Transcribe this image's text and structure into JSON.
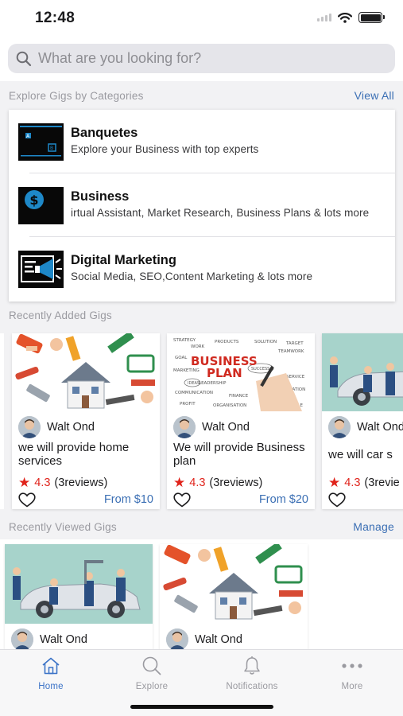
{
  "status_bar": {
    "time": "12:48"
  },
  "search": {
    "placeholder": "What are you looking for?",
    "value": ""
  },
  "categories_section": {
    "title": "Explore Gigs by Categories",
    "link": "View All"
  },
  "categories": [
    {
      "name": "Banquetes",
      "description": "Explore your Business   with top experts",
      "icon": "banquet-thumb"
    },
    {
      "name": "Business",
      "description": "irtual Assistant, Market Research, Business Plans & lots more",
      "icon": "dollar-thumb"
    },
    {
      "name": "Digital Marketing",
      "description": "Social Media, SEO,Content Marketing & lots more",
      "icon": "megaphone-thumb"
    }
  ],
  "recent_added_section": {
    "title": "Recently Added Gigs"
  },
  "gigs": [
    {
      "seller": "Walt Ond",
      "title": "we will provide home services",
      "rating": "4.3",
      "reviews": "(3reviews)",
      "price": "From $10",
      "image": "home-services-image"
    },
    {
      "seller": "Walt Ond",
      "title": "We will provide Business plan",
      "rating": "4.3",
      "reviews": "(3reviews)",
      "price": "From $20",
      "image": "business-plan-image"
    },
    {
      "seller": "Walt Ond",
      "title": "we will car s",
      "rating": "4.3",
      "reviews": "(3revie",
      "price": "",
      "image": "car-service-image"
    }
  ],
  "business_plan_art": {
    "headline_1": "BUSINESS",
    "headline_2": "PLAN"
  },
  "recent_viewed_section": {
    "title": "Recently Viewed Gigs",
    "link": "Manage"
  },
  "viewed": [
    {
      "seller": "Walt Ond",
      "image": "car-service-image"
    },
    {
      "seller": "Walt Ond",
      "image": "home-services-image"
    }
  ],
  "tabs": [
    {
      "label": "Home",
      "icon": "home-icon",
      "active": true
    },
    {
      "label": "Explore",
      "icon": "search-icon",
      "active": false
    },
    {
      "label": "Notifications",
      "icon": "bell-icon",
      "active": false
    },
    {
      "label": "More",
      "icon": "more-icon",
      "active": false
    }
  ],
  "colors": {
    "accent": "#3b6fb4",
    "rating": "#e0231b",
    "tab_active": "#3b73c7"
  }
}
